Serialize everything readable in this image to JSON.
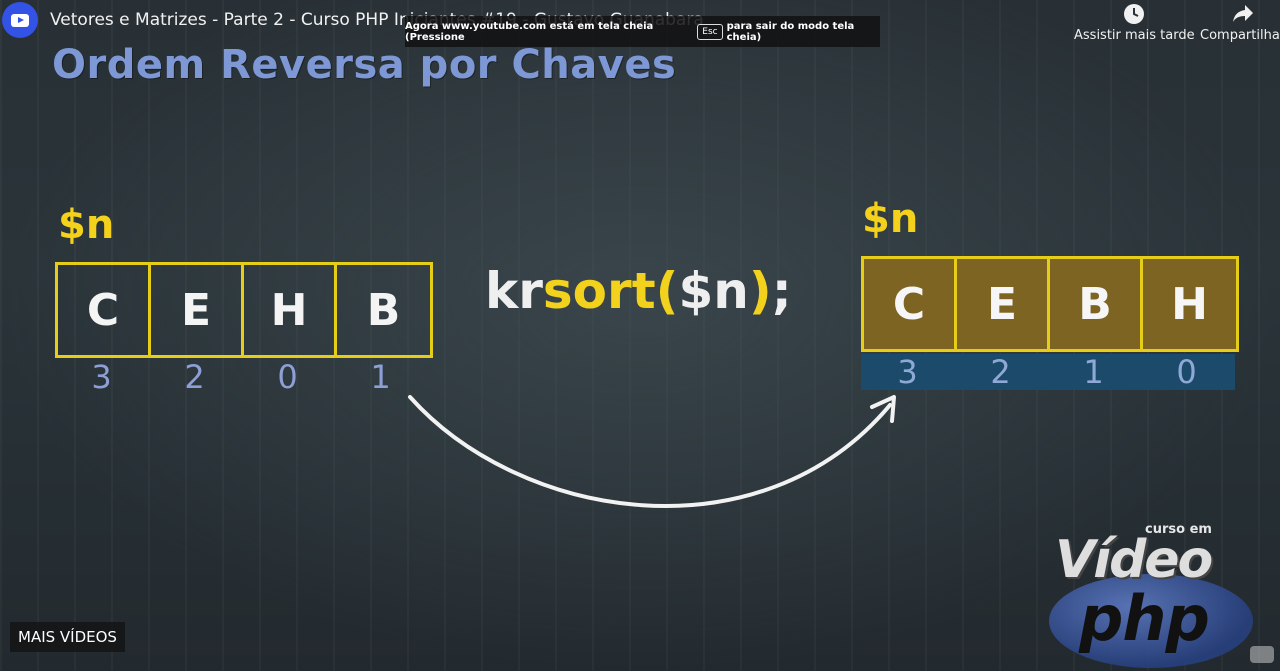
{
  "header": {
    "video_title": "Vetores e Matrizes - Parte 2 - Curso PHP Iniciantes #19 - Gustavo Guanabara",
    "watch_later_label": "Assistir mais tarde",
    "share_label": "Compartilhar"
  },
  "fullscreen_toast": {
    "prefix": "Agora www.youtube.com está em tela cheia (Pressione",
    "key": "Esc",
    "suffix": "para sair do modo tela cheia)"
  },
  "slide": {
    "title": "Ordem Reversa por Chaves",
    "left_var": "$n",
    "right_var": "$n",
    "left_values": [
      "C",
      "E",
      "H",
      "B"
    ],
    "left_keys": [
      "3",
      "2",
      "0",
      "1"
    ],
    "code_prefix": "kr",
    "code_fn": "sort",
    "code_open": "(",
    "code_arg": "$n",
    "code_close": ")",
    "code_end": ";",
    "right_values": [
      "C",
      "E",
      "B",
      "H"
    ],
    "right_keys": [
      "3",
      "2",
      "1",
      "0"
    ]
  },
  "brand": {
    "small": "curso em",
    "word1": "Vídeo",
    "word2": "php"
  },
  "footer": {
    "more_videos_label": "MAIS VÍDEOS"
  },
  "colors": {
    "title_blue": "#7e98d6",
    "yellow": "#f4d21b",
    "sorted_fill": "#7e6423",
    "keys_band": "#1b4a6b"
  }
}
